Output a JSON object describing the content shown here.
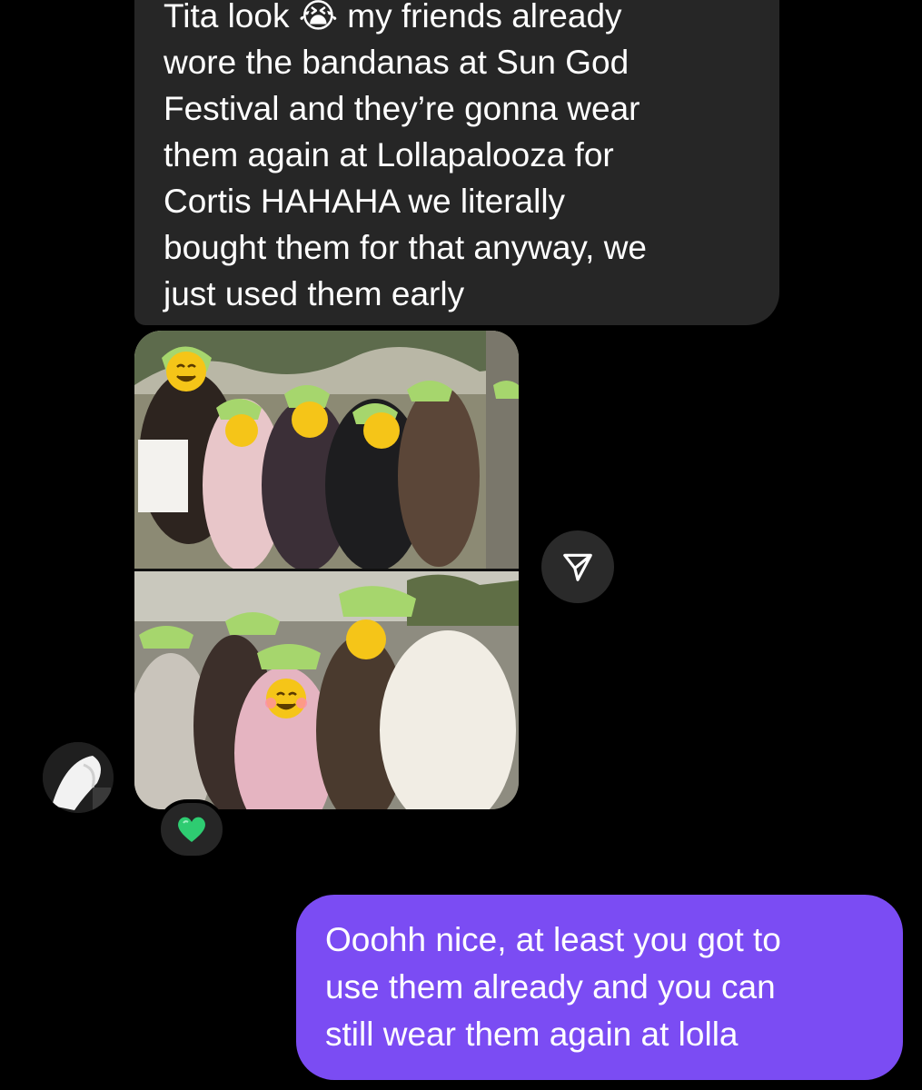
{
  "thread": {
    "incoming_message": {
      "text": "Tita look 😭 my friends already\nwore the bandanas at Sun God\nFestival and they’re gonna wear\nthem again at Lollapalooza for\nCortis HAHAHA we literally\nbought them for that anyway, we\njust used them early"
    },
    "photo_message": {
      "photos": [
        {
          "icon": "photo-friends-bandanas-1"
        },
        {
          "icon": "photo-friends-bandanas-2"
        }
      ],
      "share_icon": "send-paper-plane-icon",
      "reaction_emoji": "💚"
    },
    "sender_avatar": {
      "icon": "avatar-image"
    },
    "outgoing_message": {
      "text": "Ooohh nice, at least you got to\nuse them already and you can\nstill wear them again at lolla"
    }
  },
  "colors": {
    "background": "#000000",
    "incoming_bubble": "#262626",
    "outgoing_bubble": "#7b4cf3",
    "text": "#ffffff",
    "reaction_heart": "#2ecc71"
  }
}
